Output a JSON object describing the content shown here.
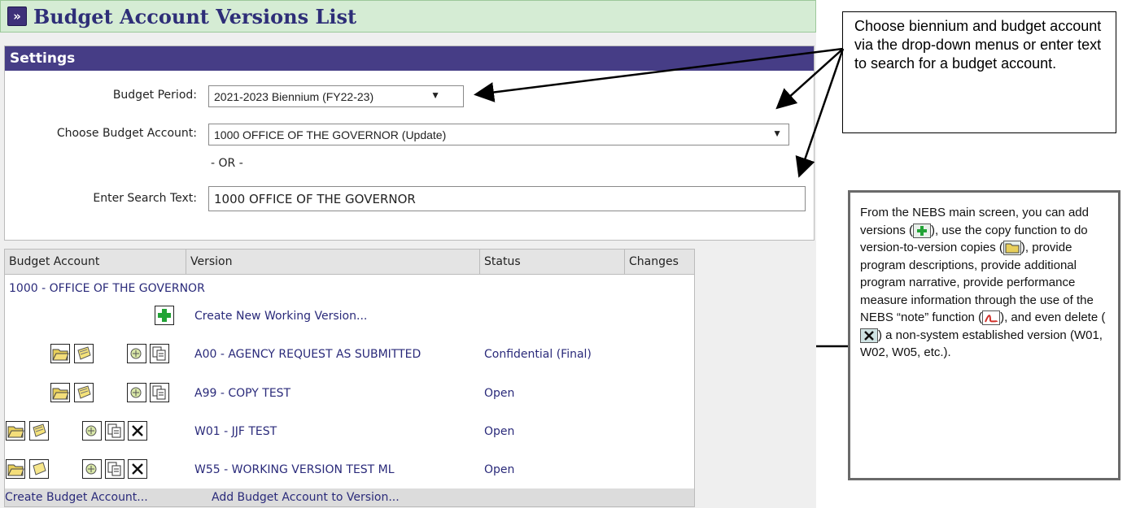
{
  "page": {
    "title": "Budget Account Versions List",
    "title_icon": "double-chevron-right-icon"
  },
  "settings": {
    "header": "Settings",
    "budget_period_label": "Budget Period:",
    "budget_period_value": "2021-2023 Biennium (FY22-23)",
    "account_label": "Choose Budget Account:",
    "account_value": "1000 OFFICE OF THE GOVERNOR (Update)",
    "or_text": "- OR -",
    "search_label": "Enter Search Text:",
    "search_value": "1000 OFFICE OF THE GOVERNOR"
  },
  "grid": {
    "columns": [
      "Budget Account",
      "Version",
      "Status",
      "Changes"
    ],
    "account_row": "1000 - OFFICE OF THE GOVERNOR",
    "create_new": "Create New Working Version...",
    "rows": [
      {
        "version": "A00 - AGENCY REQUEST AS SUBMITTED",
        "status": "Confidential (Final)",
        "buttons": [
          "open-folder-icon",
          "notes-icon",
          "copy-version-icon",
          "copy-icon"
        ]
      },
      {
        "version": "A99 - COPY TEST",
        "status": "Open",
        "buttons": [
          "open-folder-icon",
          "notes-icon",
          "copy-version-icon",
          "copy-icon"
        ]
      },
      {
        "version": "W01 - JJF TEST",
        "status": "Open",
        "buttons": [
          "open-folder-icon",
          "notes-icon",
          "copy-version-icon",
          "copy-icon",
          "delete-icon"
        ]
      },
      {
        "version": "W55 - WORKING VERSION TEST ML",
        "status": "Open",
        "buttons": [
          "open-folder-icon",
          "blank-note-icon",
          "copy-version-icon",
          "copy-icon",
          "delete-icon"
        ]
      }
    ],
    "footer_links": [
      "Create Budget Account...",
      "Add Budget Account to Version..."
    ]
  },
  "callout1": {
    "text": "Choose biennium and budget account via the drop-down menus or enter text to search for a budget account."
  },
  "callout2": {
    "t1": "From the NEBS main screen, you can add versions (",
    "t2": "), use the copy function to do version-to-version copies (",
    "t3": "), provide program descriptions, provide additional program narrative, provide performance measure information through the use of the NEBS “note” function (",
    "t4": "), and even delete (",
    "t5": ") a non-system established version (W01, W02, W05, etc.)."
  },
  "colors": {
    "title_bg": "#d5ecd4",
    "settings_header": "#463d86",
    "link": "#2a2a7a",
    "add_green": "#22a336"
  }
}
